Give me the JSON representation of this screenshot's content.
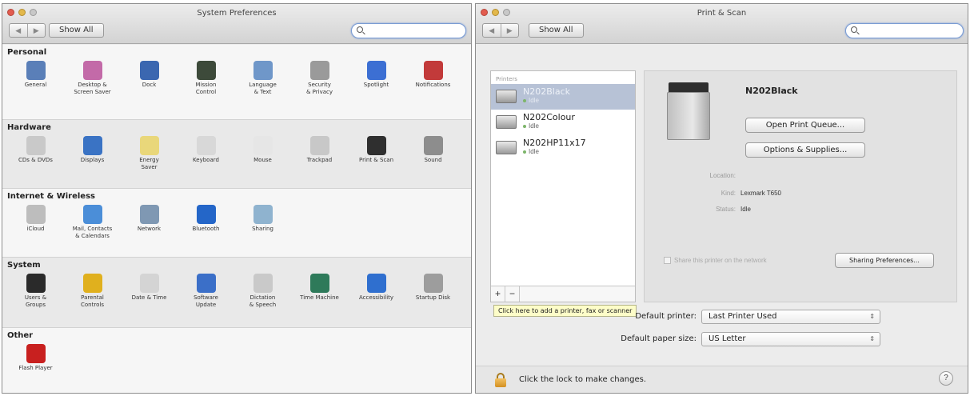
{
  "left_window": {
    "title": "System Preferences",
    "nav_back": "◀",
    "nav_fwd": "▶",
    "show_all": "Show All",
    "search_value": "",
    "sections": {
      "personal": {
        "title": "Personal",
        "items": [
          {
            "label": "General",
            "icon": "general-icon",
            "color": "#5a7fb8"
          },
          {
            "label": "Desktop &\nScreen Saver",
            "icon": "desktop-icon",
            "color": "#c36aa8"
          },
          {
            "label": "Dock",
            "icon": "dock-icon",
            "color": "#3b67b0"
          },
          {
            "label": "Mission\nControl",
            "icon": "mission-control-icon",
            "color": "#3d4a3a"
          },
          {
            "label": "Language\n& Text",
            "icon": "flag-icon",
            "color": "#6f97c9"
          },
          {
            "label": "Security\n& Privacy",
            "icon": "house-icon",
            "color": "#9a9a9a"
          },
          {
            "label": "Spotlight",
            "icon": "spotlight-icon",
            "color": "#3c6fd3"
          },
          {
            "label": "Notifications",
            "icon": "notifications-icon",
            "color": "#c23a3a"
          }
        ]
      },
      "hardware": {
        "title": "Hardware",
        "items": [
          {
            "label": "CDs & DVDs",
            "icon": "disc-icon",
            "color": "#c9c9c9"
          },
          {
            "label": "Displays",
            "icon": "display-icon",
            "color": "#3a73c4"
          },
          {
            "label": "Energy\nSaver",
            "icon": "bulb-icon",
            "color": "#e9d77a"
          },
          {
            "label": "Keyboard",
            "icon": "keyboard-icon",
            "color": "#d8d8d8"
          },
          {
            "label": "Mouse",
            "icon": "mouse-icon",
            "color": "#e6e6e6"
          },
          {
            "label": "Trackpad",
            "icon": "trackpad-icon",
            "color": "#c8c8c8"
          },
          {
            "label": "Print & Scan",
            "icon": "printer-icon",
            "color": "#2f2f2f"
          },
          {
            "label": "Sound",
            "icon": "speaker-icon",
            "color": "#8d8d8d"
          }
        ]
      },
      "internet": {
        "title": "Internet & Wireless",
        "items": [
          {
            "label": "iCloud",
            "icon": "cloud-icon",
            "color": "#bdbdbd"
          },
          {
            "label": "Mail, Contacts\n& Calendars",
            "icon": "at-icon",
            "color": "#4b8ed8"
          },
          {
            "label": "Network",
            "icon": "globe-icon",
            "color": "#7f98b3"
          },
          {
            "label": "Bluetooth",
            "icon": "bluetooth-icon",
            "color": "#2466c8"
          },
          {
            "label": "Sharing",
            "icon": "folder-icon",
            "color": "#8fb3cf"
          }
        ]
      },
      "system": {
        "title": "System",
        "items": [
          {
            "label": "Users &\nGroups",
            "icon": "users-icon",
            "color": "#2a2a2a"
          },
          {
            "label": "Parental\nControls",
            "icon": "parental-icon",
            "color": "#e0b01e"
          },
          {
            "label": "Date & Time",
            "icon": "clock-icon",
            "color": "#d4d4d4"
          },
          {
            "label": "Software\nUpdate",
            "icon": "update-icon",
            "color": "#3b6fc8"
          },
          {
            "label": "Dictation\n& Speech",
            "icon": "microphone-icon",
            "color": "#c9c9c9"
          },
          {
            "label": "Time Machine",
            "icon": "time-machine-icon",
            "color": "#2e7a5a"
          },
          {
            "label": "Accessibility",
            "icon": "accessibility-icon",
            "color": "#2f6fcf"
          },
          {
            "label": "Startup Disk",
            "icon": "disk-icon",
            "color": "#9d9d9d"
          }
        ]
      },
      "other": {
        "title": "Other",
        "items": [
          {
            "label": "Flash Player",
            "icon": "flash-icon",
            "color": "#c8201f"
          }
        ]
      }
    }
  },
  "right_window": {
    "title": "Print & Scan",
    "nav_back": "◀",
    "nav_fwd": "▶",
    "show_all": "Show All",
    "search_value": "",
    "list_header": "Printers",
    "printers": [
      {
        "name": "N202Black",
        "status": "Idle",
        "selected": true
      },
      {
        "name": "N202Colour",
        "status": "Idle",
        "selected": false
      },
      {
        "name": "N202HP11x17",
        "status": "Idle",
        "selected": false
      }
    ],
    "add_button": "+",
    "remove_button": "−",
    "detail": {
      "printer_name": "N202Black",
      "open_queue": "Open Print Queue...",
      "options_supplies": "Options & Supplies...",
      "location_label": "Location:",
      "location_value": "",
      "kind_label": "Kind:",
      "kind_value": "Lexmark T650",
      "status_label": "Status:",
      "status_value": "Idle",
      "share_label": "Share this printer on the network",
      "sharing_prefs": "Sharing Preferences..."
    },
    "tooltip": "Click here to add a printer, fax or scanner",
    "default_printer_label": "Default printer:",
    "default_printer_value": "Last Printer Used",
    "default_paper_label": "Default paper size:",
    "default_paper_value": "US Letter",
    "lock_text": "Click the lock to make changes.",
    "help": "?"
  }
}
